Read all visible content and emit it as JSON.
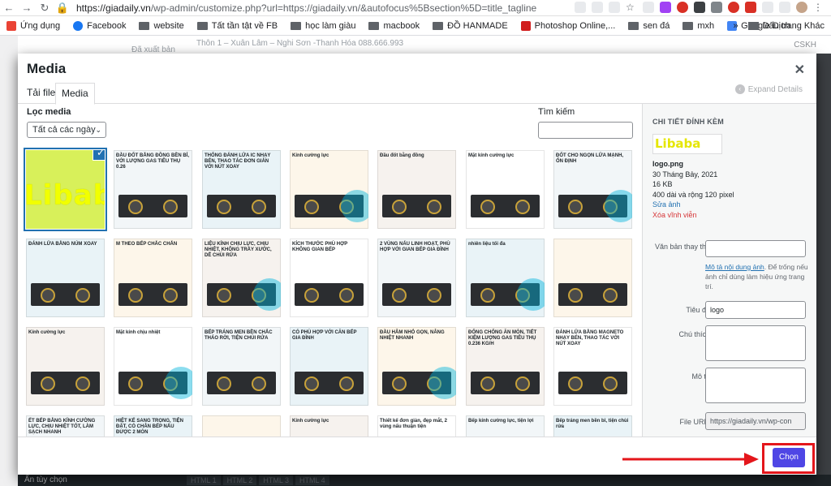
{
  "browser": {
    "url_domain": "https://giadaily.vn",
    "url_path": "/wp-admin/customize.php?url=https://giadaily.vn/&autofocus%5Bsection%5D=title_tagline",
    "bookmarks": [
      {
        "label": "Ứng dụng",
        "icon": "apps-icon",
        "color": "#ea4335"
      },
      {
        "label": "Facebook",
        "icon": "facebook-icon",
        "color": "#1877f2"
      },
      {
        "label": "website",
        "icon": "folder-icon",
        "color": "#5f6368"
      },
      {
        "label": "Tất tần tật về FB",
        "icon": "folder-icon",
        "color": "#5f6368"
      },
      {
        "label": "học làm giàu",
        "icon": "folder-icon",
        "color": "#5f6368"
      },
      {
        "label": "macbook",
        "icon": "folder-icon",
        "color": "#5f6368"
      },
      {
        "label": "ĐỒ HANMADE",
        "icon": "folder-icon",
        "color": "#5f6368"
      },
      {
        "label": "Photoshop Online,...",
        "icon": "photoshop-icon",
        "color": "#d11d1d"
      },
      {
        "label": "sen đá",
        "icon": "folder-icon",
        "color": "#5f6368"
      },
      {
        "label": "mxh",
        "icon": "folder-icon",
        "color": "#5f6368"
      },
      {
        "label": "Google Dịch",
        "icon": "google-translate-icon",
        "color": "#4285f4"
      }
    ],
    "bookmarks_overflow": "»",
    "other_bookmarks": "Dấu trang Khác"
  },
  "background": {
    "top_info": "Thôn 1 – Xuân Lâm – Nghi Sơn -Thanh Hóa    088.666.993",
    "published": "Đã xuất bản",
    "cskh": "CSKH",
    "hide_controls": "Ẩn tùy chọn",
    "bottom_tabs": [
      "HTML 1",
      "HTML 2",
      "HTML 3",
      "HTML 4"
    ]
  },
  "modal": {
    "title": "Media",
    "tabs": [
      "Tải file",
      "Media"
    ],
    "expand_details": "Expand Details",
    "filter_label": "Lọc media",
    "filter_value": "Tất cả các ngày",
    "search_label": "Tìm kiếm",
    "search_value": "",
    "tiles": [
      {
        "caption": "",
        "kind": "logo"
      },
      {
        "caption": "ĐẦU ĐỐT BẰNG ĐỒNG BỀN BỈ, VỚI LƯỢNG GAS TIÊU THỤ 0.26"
      },
      {
        "caption": "THỐNG ĐÁNH LỬA IC NHẠY BÉN, THAO TÁC ĐƠN GIẢN VỚI NÚT XOAY"
      },
      {
        "caption": "Kính cường lực"
      },
      {
        "caption": "Đầu đốt bằng đồng"
      },
      {
        "caption": "Mặt kính cường lực"
      },
      {
        "caption": "ĐỐT CHO NGỌN LỬA MẠNH, ỔN ĐỊNH"
      },
      {
        "caption": "ĐÁNH LỬA BẰNG NÚM XOAY"
      },
      {
        "caption": "M THEO BẾP CHẮC CHẮN"
      },
      {
        "caption": "LIỆU KÍNH CHỊU LỰC, CHỊU NHIỆT, KHÔNG TRẦY XƯỚC, DỄ CHÙI RỬA"
      },
      {
        "caption": "KÍCH THƯỚC PHÙ HỢP KHÔNG GIAN BẾP"
      },
      {
        "caption": "2 VÙNG NẤU LINH HOẠT, PHÙ HỢP VỚI GIAN BẾP GIA ĐÌNH"
      },
      {
        "caption": "nhiên liệu tối đa"
      },
      {
        "caption": ""
      },
      {
        "caption": "Kính cường lực"
      },
      {
        "caption": "Mặt kính chịu nhiệt"
      },
      {
        "caption": "BẾP TRÁNG MEN BỀN CHẮC THÁO RỜI, TIỆN CHÙI RỬA"
      },
      {
        "caption": "CÓ PHÙ HỢP VỚI CĂN BẾP GIA ĐÌNH"
      },
      {
        "caption": "ĐẦU HÂM NHỎ GỌN, NÂNG NHIỆT NHANH"
      },
      {
        "caption": "ĐỐNG CHỐNG ĂN MÒN, TIẾT KIỆM LƯỢNG GAS TIÊU THỤ 0.236 KG/H"
      },
      {
        "caption": "ĐÁNH LỬA BẰNG MAGNETO NHẠY BÉN, THAO TÁC VỚI NÚT XOAY"
      },
      {
        "caption": "ẾT BẾP BẰNG KÍNH CƯỜNG LỰC, CHỊU NHIỆT TỐT, LÀM SẠCH NHANH"
      },
      {
        "caption": "HIỆT KẾ SANG TRỌNG, TIỆN ĐẶT, CÓ CHÂN BẾP NẤU ĐƯỢC 2 MÓN"
      },
      {
        "caption": ""
      },
      {
        "caption": "Kính cường lực"
      },
      {
        "caption": "Thiết kế đơn giản, đẹp mắt, 2 vùng nấu thuận tiện"
      },
      {
        "caption": "Bếp kính cường lực, tiện lợi"
      },
      {
        "caption": "Bếp tráng men bền bỉ, tiện chùi rửa"
      }
    ]
  },
  "details": {
    "heading": "CHI TIẾT ĐÍNH KÈM",
    "thumb_text": "Libaba",
    "filename": "logo.png",
    "date": "30 Tháng Bảy, 2021",
    "size": "16 KB",
    "dimensions": "400 dài và rộng 120 pixel",
    "edit_link": "Sửa ảnh",
    "delete_link": "Xóa vĩnh viễn",
    "alt_label": "Văn bản thay thế",
    "alt_value": "",
    "alt_help_link": "Mô tả nội dung ảnh",
    "alt_help_text": ". Để trống nếu ảnh chỉ dùng làm hiệu ứng trang trí.",
    "title_label": "Tiêu đề",
    "title_value": "logo",
    "caption_label": "Chú thích",
    "caption_value": "",
    "description_label": "Mô tả",
    "description_value": "",
    "fileurl_label": "File URL:",
    "fileurl_value": "https://giadaily.vn/wp-con"
  },
  "footer": {
    "select_label": "Chọn"
  },
  "colors": {
    "accent": "#2271b1",
    "select_button": "#4f46e5",
    "annotation_red": "#e4161b",
    "logo_yellow": "#f1ff00"
  }
}
